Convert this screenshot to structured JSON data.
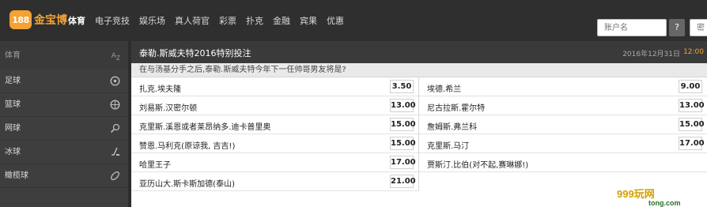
{
  "brand": {
    "badge": "188",
    "name": "金宝博"
  },
  "nav": {
    "items": [
      {
        "label": "体育",
        "active": true
      },
      {
        "label": "电子竞技",
        "active": false
      },
      {
        "label": "娱乐场",
        "active": false
      },
      {
        "label": "真人荷官",
        "active": false
      },
      {
        "label": "彩票",
        "active": false
      },
      {
        "label": "扑克",
        "active": false
      },
      {
        "label": "金融",
        "active": false
      },
      {
        "label": "宾果",
        "active": false
      },
      {
        "label": "优惠",
        "active": false
      }
    ]
  },
  "login": {
    "username_placeholder": "账户名",
    "help": "?",
    "password_placeholder": "密"
  },
  "sidebar": {
    "title": "体育",
    "sort_icon": "az-sort-icon",
    "items": [
      {
        "label": "足球",
        "icon": "soccer-ball-icon"
      },
      {
        "label": "篮球",
        "icon": "basketball-icon"
      },
      {
        "label": "网球",
        "icon": "tennis-icon"
      },
      {
        "label": "冰球",
        "icon": "ice-hockey-icon"
      },
      {
        "label": "橄榄球",
        "icon": "rugby-ball-icon"
      }
    ]
  },
  "event": {
    "title": "泰勒.斯威夫特2016特别投注",
    "date": "2016年12月31日",
    "time": "12:00",
    "question": "在与汤基分手之后,泰勒.斯威夫特今年下一任帅哥男友将是?"
  },
  "odds": {
    "left": [
      {
        "name": "扎克.埃夫隆",
        "price": "3.50"
      },
      {
        "name": "刘易斯.汉密尔顿",
        "price": "13.00"
      },
      {
        "name": "克里斯.溪恩或者莱昂纳多.迪卡普里奥",
        "price": "15.00"
      },
      {
        "name": "赞恩.马利克(原谅我, 吉吉!)",
        "price": "15.00"
      },
      {
        "name": "哈里王子",
        "price": "17.00"
      },
      {
        "name": "亚历山大.斯卡斯加德(泰山)",
        "price": "21.00"
      }
    ],
    "right": [
      {
        "name": "埃德.希兰",
        "price": "9.00"
      },
      {
        "name": "尼古拉斯.霍尔特",
        "price": "13.00"
      },
      {
        "name": "詹姆斯.弗兰科",
        "price": "15.00"
      },
      {
        "name": "克里斯.马汀",
        "price": "17.00"
      },
      {
        "name": "贾斯汀.比伯(对不起,赛琳娜!)",
        "price": ""
      }
    ]
  },
  "watermark": {
    "text": "999玩网",
    "domain": "tong.com"
  },
  "colors": {
    "accent": "#f3a233",
    "topbar": "#2f2f2f",
    "sidebar": "#3e3e3e"
  }
}
